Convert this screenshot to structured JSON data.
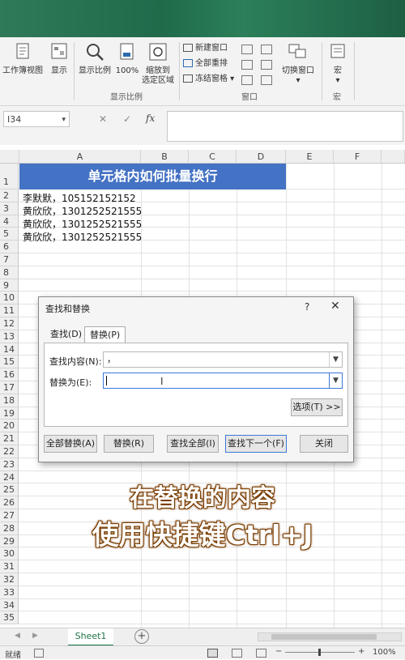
{
  "ribbon": {
    "buttons": [
      {
        "label": "工作簿视图"
      },
      {
        "label": "显示"
      },
      {
        "label": "显示比例"
      },
      {
        "label": "100%"
      },
      {
        "label": "缩放到\n选定区域"
      },
      {
        "label": "切换窗口"
      },
      {
        "label": "宏"
      }
    ],
    "window_items": [
      "新建窗口",
      "全部重排",
      "冻结窗格"
    ],
    "groups": {
      "zoom": "显示比例",
      "window": "窗口",
      "macro": "宏"
    }
  },
  "formula_bar": {
    "name_box": "I34",
    "fx": "fx",
    "cancel": "✕",
    "confirm": "✓"
  },
  "sheet": {
    "columns": [
      "A",
      "B",
      "C",
      "D",
      "E",
      "F"
    ],
    "rows": [
      "1",
      "2",
      "3",
      "4",
      "5",
      "6",
      "7",
      "8",
      "9",
      "10",
      "11",
      "12",
      "13",
      "14",
      "15",
      "16",
      "17",
      "18",
      "19",
      "20",
      "21",
      "22",
      "23",
      "24",
      "25",
      "26",
      "27",
      "28",
      "29",
      "30",
      "31",
      "32",
      "33",
      "34",
      "35"
    ],
    "title": "单元格内如何批量换行",
    "cells": [
      "李默默，105152152152",
      "黄欣欣，1301252521555",
      "黄欣欣，1301252521555",
      "黄欣欣，1301252521555"
    ]
  },
  "dialog": {
    "title": "查找和替换",
    "help": "?",
    "close": "✕",
    "tabs": [
      "查找(D)",
      "替换(P)"
    ],
    "find_label": "查找内容(N):",
    "find_value": "，",
    "replace_label": "替换为(E):",
    "replace_value": "",
    "options_button": "选项(T) >>",
    "buttons": [
      "全部替换(A)",
      "替换(R)",
      "查找全部(I)",
      "查找下一个(F)",
      "关闭"
    ]
  },
  "overlay_text": [
    "在替换的内容",
    "使用快捷键Ctrl+J"
  ],
  "sheet_tabs": {
    "active": "Sheet1",
    "add": "+"
  },
  "status": {
    "left": "就绪",
    "zoom": "100%",
    "minus": "−",
    "plus": "+"
  },
  "colors": {
    "title_fill": "#4472c4",
    "accent": "#217346",
    "overlay_stroke": "#7a3d00"
  }
}
